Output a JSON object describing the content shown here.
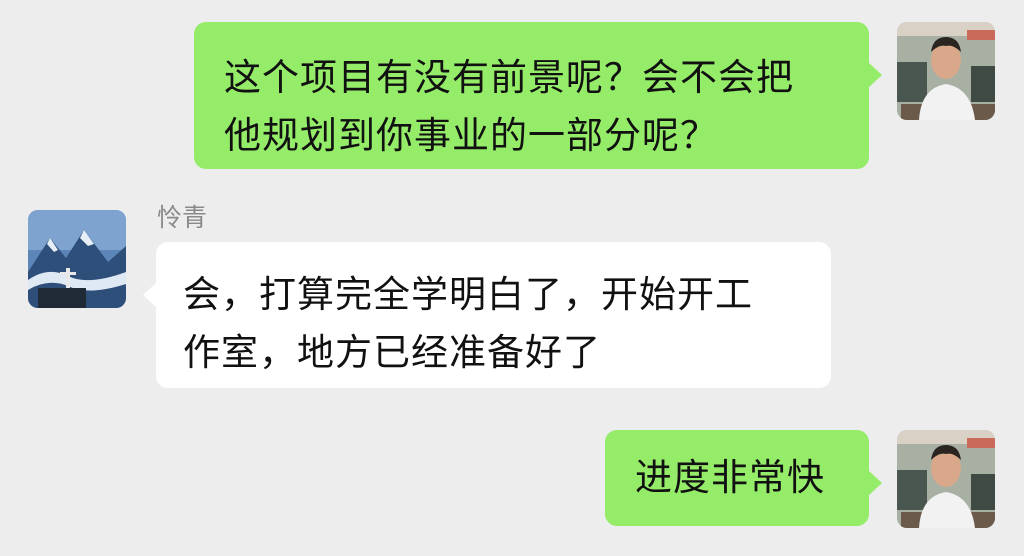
{
  "chat": {
    "contact_name": "怜青",
    "messages": [
      {
        "sender": "self",
        "text": "这个项目有没有前景呢？会不会把\n他规划到你事业的一部分呢？"
      },
      {
        "sender": "contact",
        "text": "会，打算完全学明白了，开始开工\n作室，地方已经准备好了"
      },
      {
        "sender": "self",
        "text": "进度非常快"
      }
    ]
  },
  "colors": {
    "background": "#ededed",
    "outgoing_bubble": "#95ec69",
    "incoming_bubble": "#ffffff",
    "name_text": "#8a8a8a"
  }
}
